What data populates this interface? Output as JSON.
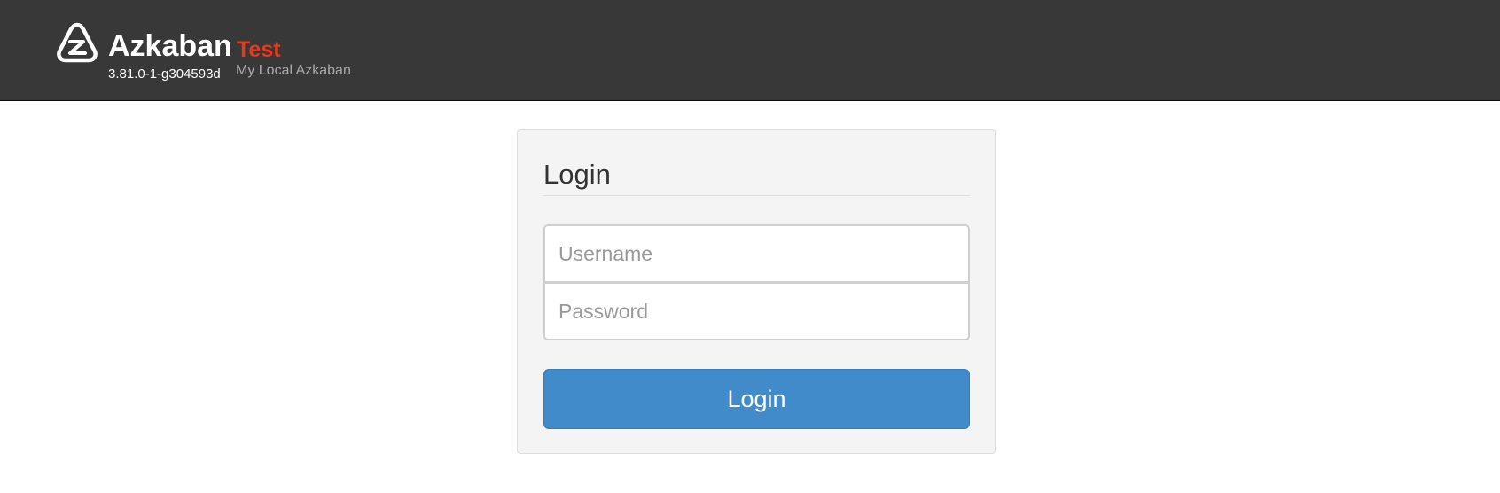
{
  "header": {
    "logo_icon": "azkaban-logo-icon",
    "brand_name": "Azkaban",
    "environment": "Test",
    "version": "3.81.0-1-g304593d",
    "subtitle": "My Local Azkaban",
    "background_color": "#383838",
    "environment_color": "#e8391b"
  },
  "login": {
    "title": "Login",
    "username_placeholder": "Username",
    "password_placeholder": "Password",
    "username_value": "",
    "password_value": "",
    "button_label": "Login",
    "button_color": "#428bca"
  }
}
